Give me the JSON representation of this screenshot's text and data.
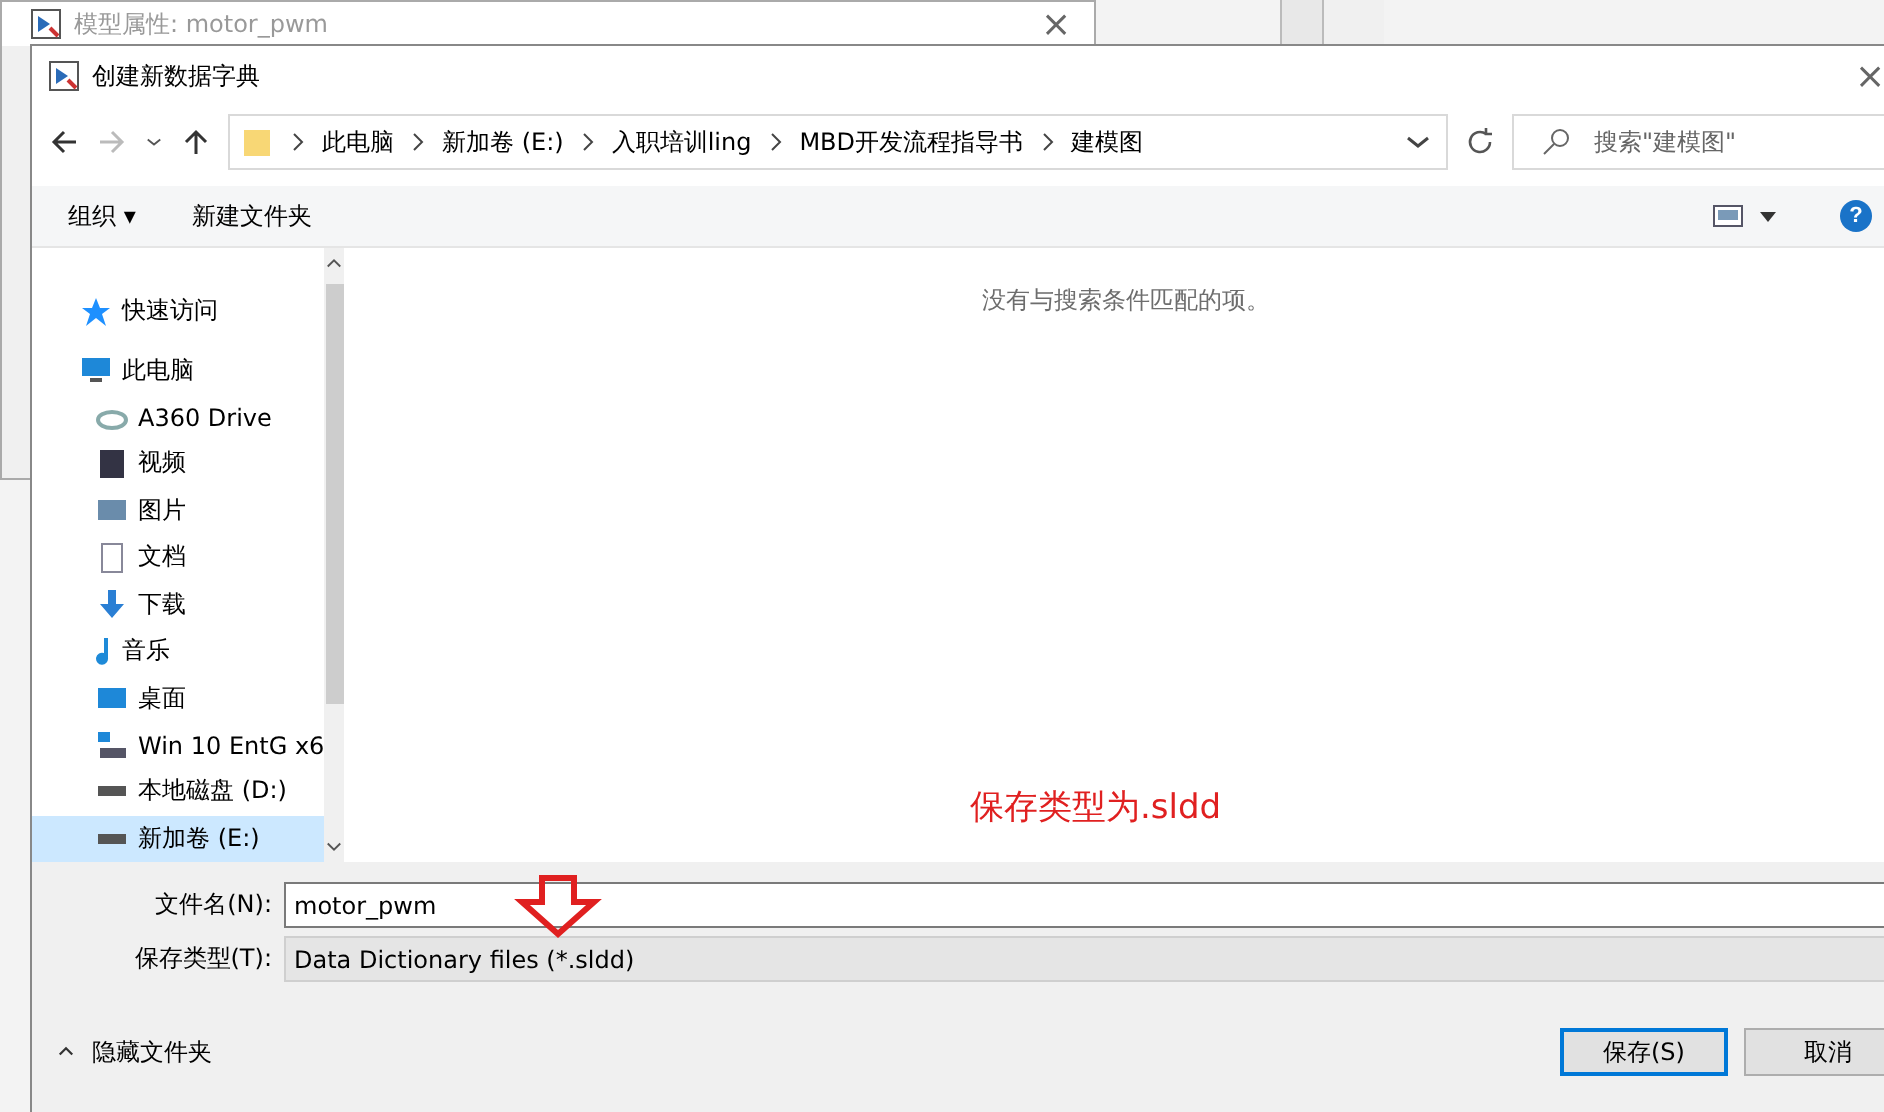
{
  "background_window": {
    "title": "模型属性: motor_pwm",
    "close": "×"
  },
  "dialog": {
    "title": "创建新数据字典",
    "close": "×"
  },
  "address_bar": {
    "crumbs": [
      "此电脑",
      "新加卷 (E:)",
      "入职培训ling",
      "MBD开发流程指导书",
      "建模图"
    ]
  },
  "search": {
    "placeholder": "搜索\"建模图\""
  },
  "toolbar": {
    "organize": "组织 ▾",
    "new_folder": "新建文件夹",
    "help": "?"
  },
  "sidebar": {
    "items": [
      {
        "label": "快速访问",
        "kind": "star",
        "group": true,
        "selected": false
      },
      {
        "label": "此电脑",
        "kind": "pc",
        "group": true,
        "selected": false
      },
      {
        "label": "A360 Drive",
        "kind": "cloud",
        "group": false,
        "selected": false
      },
      {
        "label": "视频",
        "kind": "video",
        "group": false,
        "selected": false
      },
      {
        "label": "图片",
        "kind": "picture",
        "group": false,
        "selected": false
      },
      {
        "label": "文档",
        "kind": "document",
        "group": false,
        "selected": false
      },
      {
        "label": "下载",
        "kind": "download",
        "group": false,
        "selected": false
      },
      {
        "label": "音乐",
        "kind": "music",
        "group": false,
        "selected": false
      },
      {
        "label": "桌面",
        "kind": "desktop",
        "group": false,
        "selected": false
      },
      {
        "label": "Win 10 EntG x6",
        "kind": "netdrive",
        "group": false,
        "selected": false
      },
      {
        "label": "本地磁盘 (D:)",
        "kind": "drive",
        "group": false,
        "selected": false
      },
      {
        "label": "新加卷 (E:)",
        "kind": "drive",
        "group": false,
        "selected": true
      }
    ]
  },
  "content": {
    "empty_message": "没有与搜索条件匹配的项。",
    "annotation": "保存类型为.sldd"
  },
  "form": {
    "filename_label": "文件名(N):",
    "filename": "motor_pwm",
    "type_label": "保存类型(T):",
    "type_value": "Data Dictionary files (*.sldd)"
  },
  "footer": {
    "hide_folders": "隐藏文件夹",
    "save": "保存(S)",
    "cancel": "取消"
  }
}
